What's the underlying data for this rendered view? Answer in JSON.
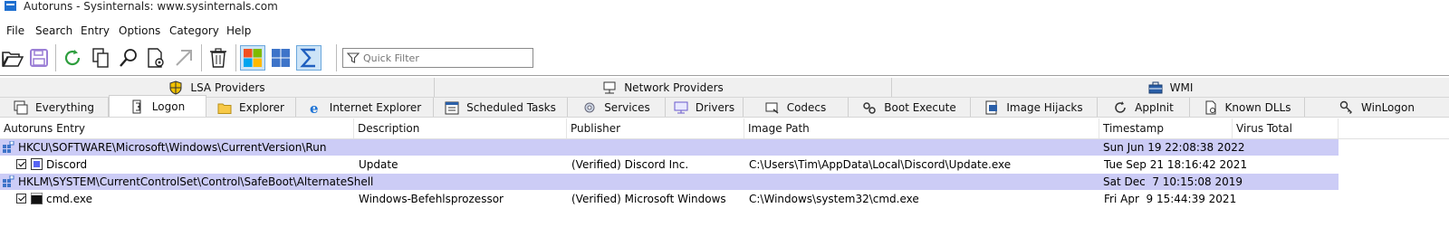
{
  "window": {
    "title": "Autoruns - Sysinternals: www.sysinternals.com"
  },
  "menu": [
    "File",
    "Search",
    "Entry",
    "Options",
    "Category",
    "Help"
  ],
  "toolbar": {
    "buttons": [
      "open-icon",
      "save-icon",
      "refresh-icon",
      "copy-icon",
      "find-icon",
      "properties-icon",
      "jump-icon",
      "delete-icon",
      "windows-logo-icon",
      "tiles-icon",
      "sigma-icon"
    ],
    "filter_placeholder": "Quick Filter"
  },
  "tabs_top": [
    {
      "label": "LSA Providers",
      "icon": "shield-icon"
    },
    {
      "label": "Network Providers",
      "icon": "network-icon"
    },
    {
      "label": "WMI",
      "icon": "briefcase-icon"
    }
  ],
  "tabs_bottom": [
    {
      "label": "Everything",
      "icon": "everything-icon"
    },
    {
      "label": "Logon",
      "icon": "logon-icon",
      "active": true
    },
    {
      "label": "Explorer",
      "icon": "folder-icon"
    },
    {
      "label": "Internet Explorer",
      "icon": "ie-icon"
    },
    {
      "label": "Scheduled Tasks",
      "icon": "calendar-icon"
    },
    {
      "label": "Services",
      "icon": "services-icon"
    },
    {
      "label": "Drivers",
      "icon": "monitor-icon"
    },
    {
      "label": "Codecs",
      "icon": "codec-icon"
    },
    {
      "label": "Boot Execute",
      "icon": "gears-icon"
    },
    {
      "label": "Image Hijacks",
      "icon": "hijack-icon"
    },
    {
      "label": "AppInit",
      "icon": "appinit-icon"
    },
    {
      "label": "Known DLLs",
      "icon": "dll-icon"
    },
    {
      "label": "WinLogon",
      "icon": "key-icon"
    }
  ],
  "columns": [
    "Autoruns Entry",
    "Description",
    "Publisher",
    "Image Path",
    "Timestamp",
    "Virus Total"
  ],
  "rows": [
    {
      "type": "group",
      "entry": "HKCU\\SOFTWARE\\Microsoft\\Windows\\CurrentVersion\\Run",
      "timestamp": "Sun Jun 19 22:08:38 2022"
    },
    {
      "type": "item",
      "entry": "Discord",
      "description": "Update",
      "publisher": "(Verified) Discord Inc.",
      "image_path": "C:\\Users\\Tim\\AppData\\Local\\Discord\\Update.exe",
      "timestamp": "Tue Sep 21 18:16:42 2021",
      "checked": true
    },
    {
      "type": "group",
      "entry": "HKLM\\SYSTEM\\CurrentControlSet\\Control\\SafeBoot\\AlternateShell",
      "timestamp": "Sat Dec  7 10:15:08 2019"
    },
    {
      "type": "item",
      "entry": "cmd.exe",
      "description": "Windows-Befehlsprozessor",
      "publisher": "(Verified) Microsoft Windows",
      "image_path": "C:\\Windows\\system32\\cmd.exe",
      "timestamp": "Fri Apr  9 15:44:39 2021",
      "checked": true
    }
  ]
}
